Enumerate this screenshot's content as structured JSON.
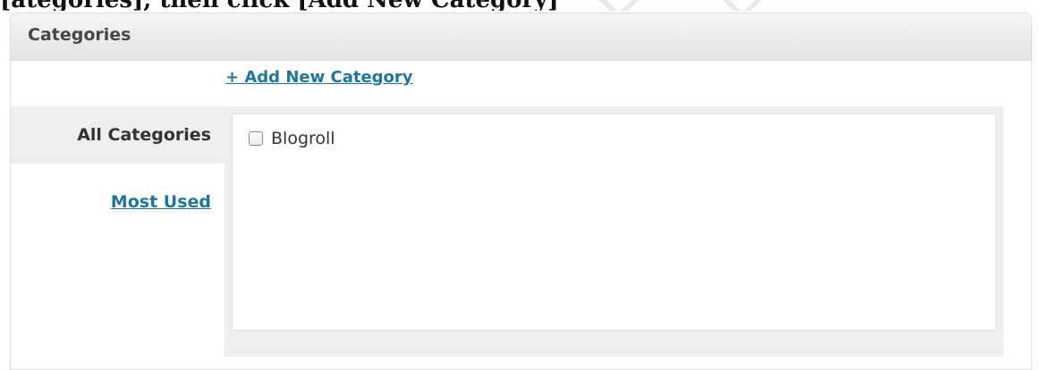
{
  "page_heading_fragment": "[ategories], then click [Add New Category]",
  "categories_panel": {
    "title": "Categories",
    "add_new_link": "+ Add New Category",
    "tabs": [
      {
        "label": "All Categories",
        "active": true
      },
      {
        "label": "Most Used",
        "active": false
      }
    ],
    "items": [
      {
        "label": "Blogroll",
        "checked": false
      }
    ]
  },
  "colors": {
    "link": "#21759b",
    "header_bg": "#e9e9e9",
    "tab_active_bg": "#eeeeee",
    "text": "#333333"
  }
}
